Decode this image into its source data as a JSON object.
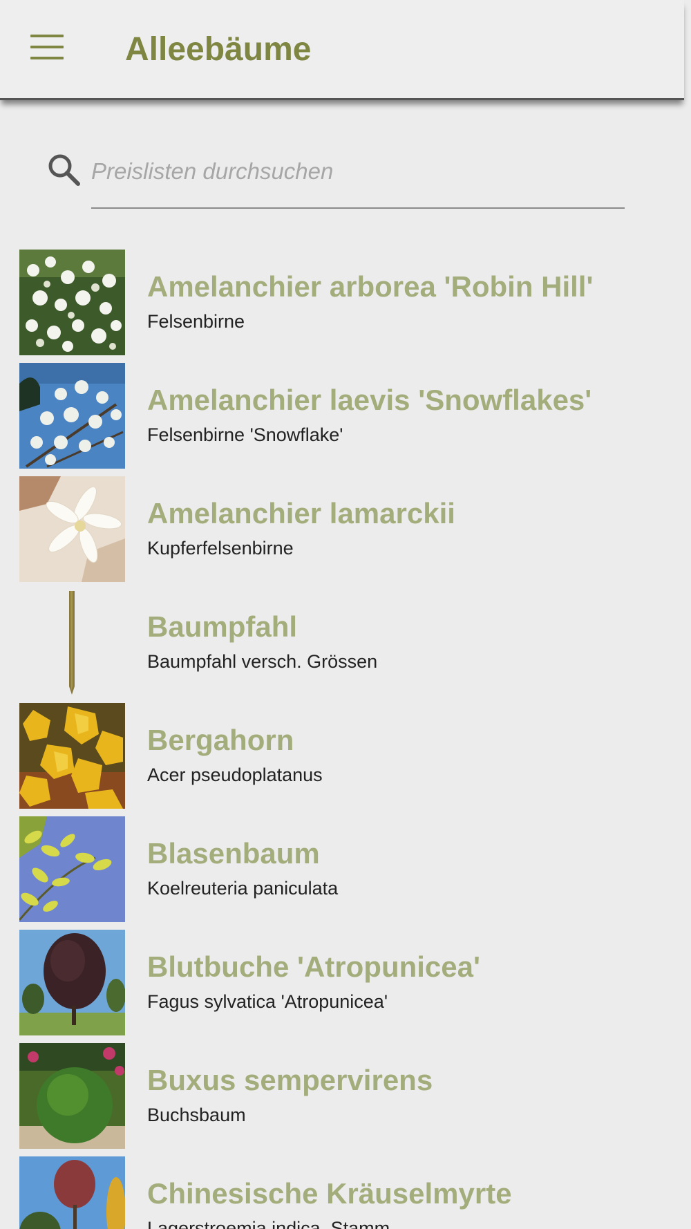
{
  "header": {
    "title": "Alleebäume",
    "menu_icon": "hamburger-menu-icon"
  },
  "search": {
    "placeholder": "Preislisten durchsuchen",
    "value": "",
    "icon": "search-icon"
  },
  "colors": {
    "accent": "#7e8642",
    "item_title": "#a3ad7c",
    "background": "#ececec"
  },
  "items": [
    {
      "title": "Amelanchier arborea 'Robin Hill'",
      "subtitle": "Felsenbirne",
      "image": "white-blossom-photo"
    },
    {
      "title": "Amelanchier laevis 'Snowflakes'",
      "subtitle": "Felsenbirne 'Snowflake'",
      "image": "white-blossom-sky-photo"
    },
    {
      "title": "Amelanchier lamarckii",
      "subtitle": "Kupferfelsenbirne",
      "image": "blossom-closeup-photo"
    },
    {
      "title": "Baumpfahl",
      "subtitle": "Baumpfahl versch. Grössen",
      "image": "wooden-stake-image"
    },
    {
      "title": "Bergahorn",
      "subtitle": "Acer pseudoplatanus",
      "image": "yellow-maple-leaves-photo"
    },
    {
      "title": "Blasenbaum",
      "subtitle": "Koelreuteria paniculata",
      "image": "yellow-leaves-sky-photo"
    },
    {
      "title": "Blutbuche 'Atropunicea'",
      "subtitle": "Fagus sylvatica 'Atropunicea'",
      "image": "copper-beech-tree-photo"
    },
    {
      "title": "Buxus sempervirens",
      "subtitle": "Buchsbaum",
      "image": "boxwood-shrub-photo"
    },
    {
      "title": "Chinesische Kräuselmyrte",
      "subtitle": "Lagerstroemia indica, Stamm",
      "image": "crape-myrtle-tree-photo"
    }
  ]
}
